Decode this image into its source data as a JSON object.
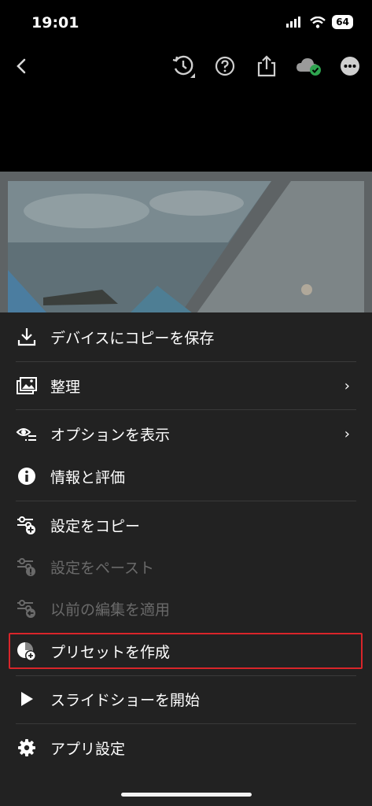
{
  "status_bar": {
    "time": "19:01",
    "battery": "64"
  },
  "toolbar": {
    "back_icon": "chevron-left-icon",
    "icons": [
      "history-icon",
      "help-icon",
      "share-icon",
      "cloud-sync-icon",
      "more-icon"
    ]
  },
  "menu": {
    "items": [
      {
        "label": "デバイスにコピーを保存",
        "icon": "download-icon"
      },
      {
        "label": "整理",
        "icon": "folder-image-icon",
        "has_submenu": true
      },
      {
        "label": "オプションを表示",
        "icon": "view-options-icon",
        "has_submenu": true
      },
      {
        "label": "情報と評価",
        "icon": "info-icon"
      },
      {
        "label": "設定をコピー",
        "icon": "settings-copy-icon"
      },
      {
        "label": "設定をペースト",
        "icon": "settings-paste-icon",
        "disabled": true
      },
      {
        "label": "以前の編集を適用",
        "icon": "settings-previous-icon",
        "disabled": true
      },
      {
        "label": "プリセットを作成",
        "icon": "create-preset-icon",
        "highlighted": true
      },
      {
        "label": "スライドショーを開始",
        "icon": "play-icon"
      },
      {
        "label": "アプリ設定",
        "icon": "gear-icon"
      }
    ],
    "chevron": "›"
  },
  "colors": {
    "sheet": "#222222",
    "highlight_border": "#d9252a",
    "check_green": "#2ea44f"
  }
}
